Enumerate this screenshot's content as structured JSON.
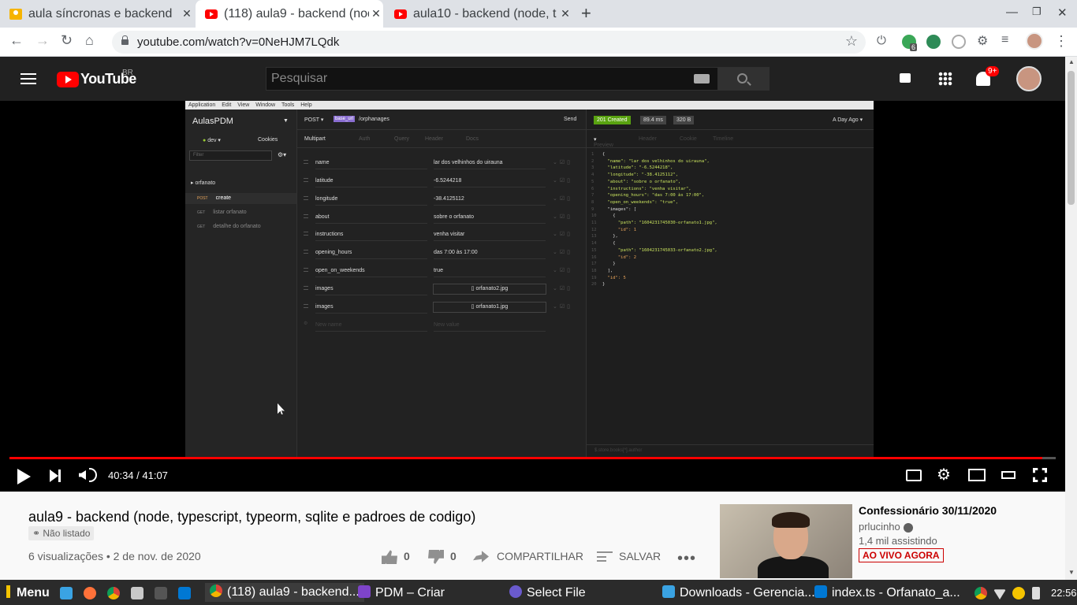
{
  "browser": {
    "tabs": [
      {
        "title": "aula síncronas e backend",
        "icon": "classroom-icon"
      },
      {
        "title": "(118) aula9 - backend (node",
        "icon": "youtube-icon"
      },
      {
        "title": "aula10 - backend (node, t",
        "icon": "youtube-icon"
      }
    ],
    "url": "youtube.com/watch?v=0NeHJM7LQdk",
    "extension_badge": "6"
  },
  "youtube": {
    "logo_text": "YouTube",
    "region": "BR",
    "search_placeholder": "Pesquisar",
    "notification_count": "9+"
  },
  "video_frame": {
    "menu": [
      "Application",
      "Edit",
      "View",
      "Window",
      "Tools",
      "Help"
    ],
    "workspace": "AulasPDM",
    "env": "dev",
    "cookies": "Cookies",
    "filter_placeholder": "Filter",
    "folder": "orfanato",
    "requests": [
      {
        "method": "POST",
        "name": "create"
      },
      {
        "method": "GET",
        "name": "listar orfanato"
      },
      {
        "method": "GET",
        "name": "detalhe do orfanato"
      }
    ],
    "method": "POST",
    "base_url_tag": "base_url",
    "path": "/orphanages",
    "send": "Send",
    "body_tabs": [
      "Multipart",
      "Auth",
      "Query",
      "Header",
      "Docs"
    ],
    "fields": [
      {
        "name": "name",
        "value": "lar dos velhinhos do uirauna"
      },
      {
        "name": "latitude",
        "value": "-6.5244218"
      },
      {
        "name": "longitude",
        "value": "-38.4125112"
      },
      {
        "name": "about",
        "value": "sobre o orfanato"
      },
      {
        "name": "instructions",
        "value": "venha visitar"
      },
      {
        "name": "opening_hours",
        "value": "das 7:00 às 17:00"
      },
      {
        "name": "open_on_weekends",
        "value": "true"
      }
    ],
    "files": [
      {
        "name": "images",
        "value": "orfanato2.jpg"
      },
      {
        "name": "images",
        "value": "orfanato1.jpg"
      }
    ],
    "new_name": "New name",
    "new_value": "New value",
    "status": "201 Created",
    "time": "89.4 ms",
    "size": "320 B",
    "ago": "A Day Ago",
    "resp_tabs": [
      "Preview",
      "Header",
      "Cookie",
      "Timeline"
    ],
    "json_lines": [
      "{",
      "  \"name\": \"lar dos velhinhos do uirauna\",",
      "  \"latitude\": \"-6.5244218\",",
      "  \"longitude\": \"-38.4125112\",",
      "  \"about\": \"sobre o orfanato\",",
      "  \"instructions\": \"venha visitar\",",
      "  \"opening_hours\": \"das 7:00 às 17:00\",",
      "  \"open_on_weekends\": \"true\",",
      "  \"images\": [",
      "    {",
      "      \"path\": \"1604231745030-orfanato1.jpg\",",
      "      \"id\": 1",
      "    },",
      "    {",
      "      \"path\": \"1604231745033-orfanato2.jpg\",",
      "      \"id\": 2",
      "    }",
      "  ],",
      "  \"id\": 5",
      "}"
    ],
    "footer_filter": "$.store.books[*].author"
  },
  "player": {
    "time": "40:34 / 41:07",
    "progress": 0.987
  },
  "video": {
    "title": "aula9 - backend (node, typescript, typeorm, sqlite e padroes de codigo)",
    "unlisted": "Não listado",
    "stats": "6 visualizações • 2 de nov. de 2020",
    "likes": "0",
    "dislikes": "0",
    "share": "COMPARTILHAR",
    "save": "SALVAR"
  },
  "live": {
    "title": "Confessionário 30/11/2020",
    "channel": "prlucinho",
    "views": "1,4 mil assistindo",
    "badge": "AO VIVO AGORA"
  },
  "taskbar": {
    "menu": "Menu",
    "tasks": [
      "(118) aula9 - backend...",
      "PDM – Criar",
      "Select File",
      "Downloads - Gerencia...",
      "index.ts - Orfanato_a..."
    ],
    "clock": "22:56"
  },
  "colors": {
    "youtube_red": "#ff0000",
    "insomnia_purple": "#8a6ed1",
    "status_green": "#59a210"
  }
}
